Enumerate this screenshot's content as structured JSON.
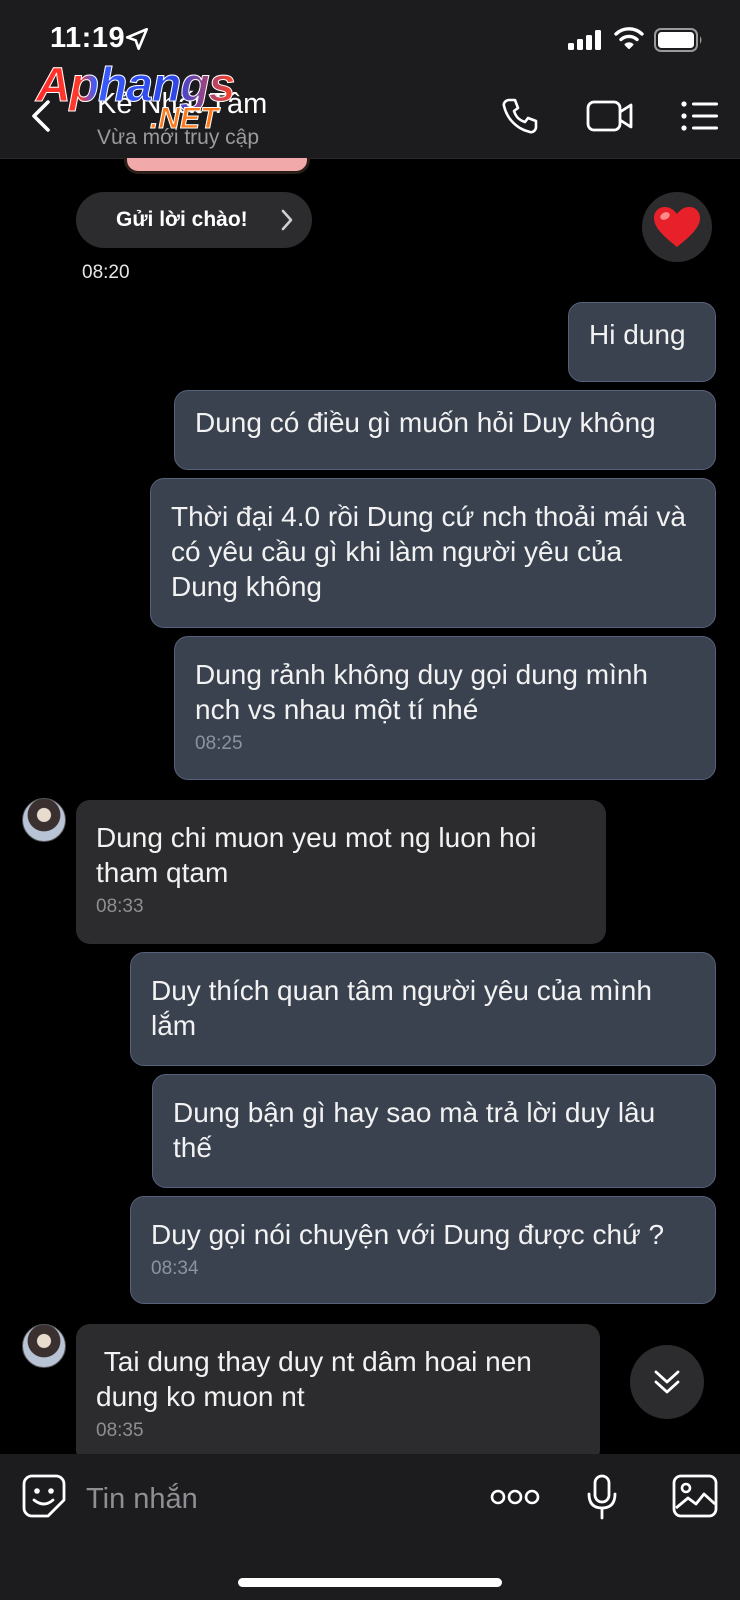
{
  "status_bar": {
    "time": "11:19"
  },
  "header": {
    "contact_name": "Kẻ Nhất Tâm",
    "contact_status": "Vừa mới truy cập",
    "watermark": {
      "main": "Aphangs",
      "sub": ".NET"
    }
  },
  "greeting": {
    "button_label": "Gửi lời chào!",
    "time": "08:20"
  },
  "messages": [
    {
      "dir": "out",
      "text": "Hi dung",
      "time": ""
    },
    {
      "dir": "out",
      "text": "Dung có điều gì muốn hỏi Duy không",
      "time": ""
    },
    {
      "dir": "out",
      "text": "Thời đại 4.0 rồi Dung cứ nch thoải mái và có yêu cầu gì khi làm người yêu của Dung không",
      "time": ""
    },
    {
      "dir": "out",
      "text": "Dung rảnh không duy gọi dung mình nch vs nhau một tí nhé",
      "time": "08:25"
    },
    {
      "dir": "in",
      "text": "Dung chi muon yeu mot ng luon hoi tham qtam",
      "time": "08:33"
    },
    {
      "dir": "out",
      "text": "Duy thích quan tâm người yêu của mình lắm",
      "time": ""
    },
    {
      "dir": "out",
      "text": "Dung bận gì hay sao mà trả lời duy lâu thế",
      "time": ""
    },
    {
      "dir": "out",
      "text": "Duy gọi nói chuyện với Dung được chứ ?",
      "time": "08:34"
    },
    {
      "dir": "in",
      "text": " Tai dung thay duy nt dâm hoai nen dung ko muon nt",
      "time": "08:35"
    }
  ],
  "input": {
    "placeholder": "Tin nhắn"
  },
  "colors": {
    "outgoing_bubble": "#3a4250",
    "incoming_bubble": "#2c2c2e",
    "background": "#000000",
    "heart": "#e8202a"
  },
  "icons": [
    "location-arrow-icon",
    "signal-icon",
    "wifi-icon",
    "battery-icon",
    "back-chevron-icon",
    "phone-icon",
    "video-camera-icon",
    "menu-list-icon",
    "chevron-right-icon",
    "heart-icon",
    "double-chevron-down-icon",
    "sticker-smiley-icon",
    "more-dots-icon",
    "microphone-icon",
    "image-gallery-icon"
  ]
}
